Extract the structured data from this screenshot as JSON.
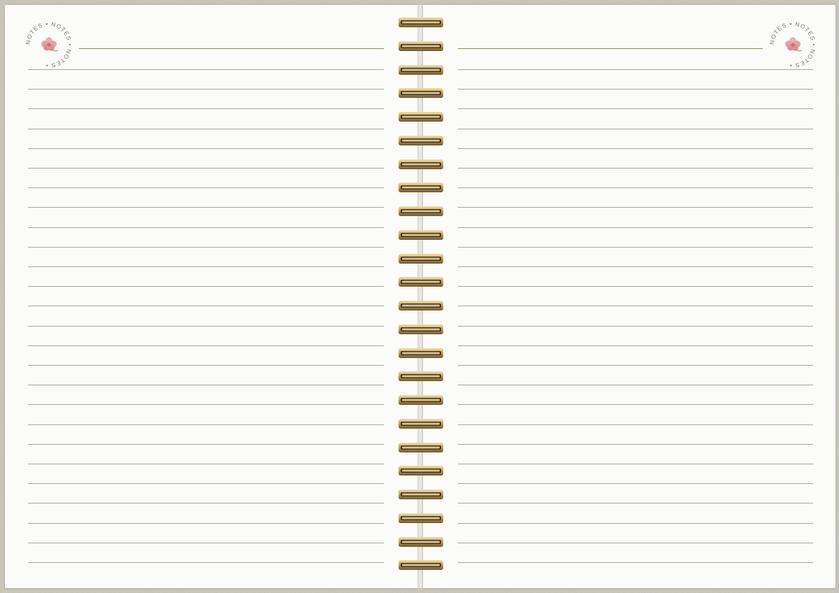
{
  "notebook": {
    "left_page": {
      "stamp_text": "NOTES • NOTES • NOTES •",
      "stamp_icon": "flower-icon",
      "ruled_line_count": 26
    },
    "right_page": {
      "stamp_text": "NOTES • NOTES • NOTES •",
      "stamp_icon": "flower-icon",
      "ruled_line_count": 26
    },
    "binding": {
      "ring_count": 24
    },
    "colors": {
      "cover": "#c9c6ba",
      "paper": "#fbfbfa",
      "ruled_line": "#a6a6a6",
      "header_line": "#8c8866",
      "ring_gold": "#c8a45a",
      "flower_pink": "#e8a0a6"
    }
  }
}
